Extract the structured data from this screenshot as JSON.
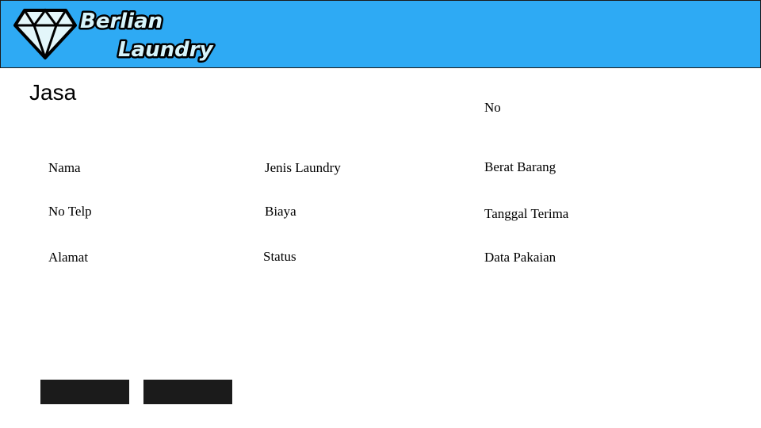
{
  "header": {
    "logo_icon": "diamond-icon",
    "brand_line1": "Berlian",
    "brand_line2": "Laundry",
    "background_color": "#2eaaf4"
  },
  "page": {
    "title": "Jasa"
  },
  "fields": {
    "no": "No",
    "nama": "Nama",
    "jenis_laundry": "Jenis Laundry",
    "berat_barang": "Berat Barang",
    "no_telp": "No Telp",
    "biaya": "Biaya",
    "tanggal_terima": "Tanggal Terima",
    "alamat": "Alamat",
    "status": "Status",
    "data_pakaian": "Data Pakaian"
  },
  "actions": {
    "button1_label": "",
    "button2_label": "",
    "button_color": "#1b1b1b"
  }
}
